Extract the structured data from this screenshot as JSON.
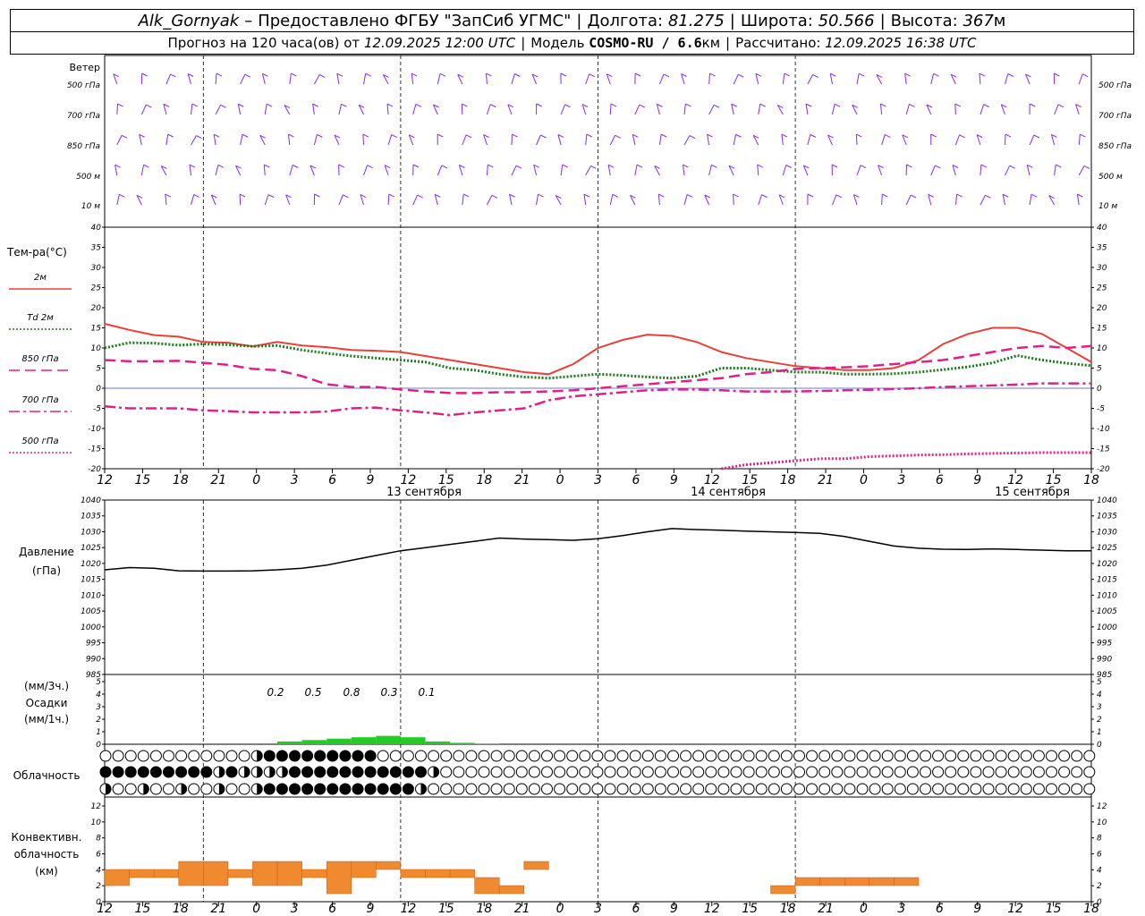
{
  "header": {
    "station": "Alk_Gornyak",
    "provider": "Предоставлено ФГБУ \"ЗапСиб УГМС\"",
    "lon_label": "Долгота:",
    "lon_value": "81.275",
    "lat_label": "Широта:",
    "lat_value": "50.566",
    "alt_label": "Высота:",
    "alt_value": "367",
    "alt_unit": "м",
    "forecast_prefix": "Прогноз на 120 часа(ов) от",
    "forecast_start": "12.09.2025 12:00 UTC",
    "model_label": "Модель",
    "model_value": "COSMO-RU / 6.6",
    "model_unit": "км",
    "computed_label": "Рассчитано:",
    "computed_value": "12.09.2025 16:38 UTC"
  },
  "wind_panel": {
    "title": "Ветер",
    "levels": [
      "500 гПа",
      "700 гПа",
      "850 гПа",
      "500 м",
      "10 м"
    ],
    "barb_color": "#8a2be2"
  },
  "time_axis": {
    "hour_labels": [
      "12",
      "15",
      "18",
      "21",
      "0",
      "3",
      "6",
      "9",
      "12",
      "15",
      "18",
      "21",
      "0",
      "3",
      "6",
      "9",
      "12",
      "15",
      "18",
      "21",
      "0",
      "3",
      "6",
      "9",
      "12",
      "15",
      "18"
    ],
    "day_labels": [
      "13 сентября",
      "14 сентября",
      "15 сентября"
    ]
  },
  "temp_panel": {
    "title": "Тем-ра(°C)",
    "y_ticks": [
      "40",
      "35",
      "30",
      "25",
      "20",
      "15",
      "10",
      "5",
      "0",
      "-5",
      "-10",
      "-15",
      "-20"
    ],
    "legend": [
      {
        "label": "2м",
        "color": "#e8403a",
        "style": "solid"
      },
      {
        "label": "Td  2м",
        "color": "#1a7a1a",
        "style": "dotted"
      },
      {
        "label": "850 гПа",
        "color": "#e0208a",
        "style": "dashed"
      },
      {
        "label": "700 гПа",
        "color": "#e0208a",
        "style": "dashdot"
      },
      {
        "label": "500 гПа",
        "color": "#e0208a",
        "style": "dotted"
      }
    ]
  },
  "pressure_panel": {
    "title_line1": "Давление",
    "title_line2": "(гПа)",
    "y_ticks": [
      "1040",
      "1035",
      "1030",
      "1025",
      "1020",
      "1015",
      "1010",
      "1005",
      "1000",
      "995",
      "990",
      "985"
    ]
  },
  "precip_panel": {
    "unit3h": "(мм/3ч.)",
    "title": "Осадки",
    "unit1h": "(мм/1ч.)",
    "y_ticks": [
      "5",
      "4",
      "3",
      "2",
      "1",
      "0"
    ],
    "amount_labels": [
      "0.2",
      "0.5",
      "0.8",
      "0.3",
      "0.1"
    ],
    "bar_color": "#22cc22"
  },
  "cloud_panel": {
    "title": "Облачность"
  },
  "conv_panel": {
    "title_line1": "Конвективн.",
    "title_line2": "облачность",
    "title_line3": "(км)",
    "y_ticks": [
      "12",
      "10",
      "8",
      "6",
      "4",
      "2",
      "0"
    ],
    "bar_color": "#f08a30"
  },
  "chart_data": {
    "type": "line",
    "time_hours": [
      0,
      3,
      6,
      9,
      12,
      15,
      18,
      21,
      24,
      27,
      30,
      33,
      36,
      39,
      42,
      45,
      48,
      51,
      54,
      57,
      60,
      63,
      66,
      69,
      72,
      75,
      78,
      81,
      84,
      87,
      90,
      93,
      96,
      99,
      102,
      105,
      108,
      111,
      114,
      117,
      120
    ],
    "series": [
      {
        "name": "2м",
        "unit": "°C",
        "values": [
          16,
          14.5,
          13.2,
          12.8,
          11.5,
          11.3,
          10.4,
          11.5,
          10.6,
          10.2,
          9.5,
          9.3,
          9,
          8,
          7,
          6,
          5,
          4,
          3.5,
          6,
          10,
          12,
          13.3,
          13,
          11.5,
          9,
          7.5,
          6.5,
          5.5,
          5,
          4.5,
          4.5,
          5,
          7,
          11,
          13.5,
          15,
          15,
          13.5,
          10,
          6.5
        ]
      },
      {
        "name": "Td  2м",
        "unit": "°C",
        "values": [
          10,
          11.3,
          11.2,
          10.7,
          11,
          10.8,
          10.4,
          10.6,
          9.5,
          8.7,
          8,
          7.5,
          7,
          6.5,
          5,
          4.5,
          3.5,
          2.8,
          2.5,
          3,
          3.5,
          3.2,
          2.8,
          2.5,
          3,
          5,
          5,
          4.5,
          4,
          4,
          3.5,
          3.5,
          3.6,
          4,
          4.6,
          5.3,
          6.3,
          8.1,
          7,
          6.2,
          5.6
        ]
      },
      {
        "name": "850 гПа",
        "unit": "°C",
        "values": [
          7,
          6.7,
          6.7,
          6.8,
          6.3,
          5.8,
          4.8,
          4.5,
          3,
          1,
          0.3,
          0.3,
          -0.3,
          -0.8,
          -1.2,
          -1.2,
          -1,
          -1,
          -0.8,
          -0.5,
          0,
          0.5,
          1,
          1.5,
          2,
          2.5,
          3.5,
          4,
          4.8,
          5,
          5.2,
          5.5,
          6,
          6.5,
          7,
          8,
          9,
          10,
          10.5,
          10,
          10.5
        ]
      },
      {
        "name": "700 гПа",
        "unit": "°C",
        "values": [
          -4.5,
          -5,
          -5,
          -5,
          -5.5,
          -5.7,
          -6,
          -6,
          -6,
          -5.8,
          -5,
          -4.8,
          -5.5,
          -6,
          -6.7,
          -6,
          -5.5,
          -5,
          -3,
          -2,
          -1.5,
          -1,
          -0.5,
          -0.3,
          -0.3,
          -0.5,
          -0.8,
          -0.8,
          -0.8,
          -0.7,
          -0.5,
          -0.4,
          -0.2,
          0,
          0.3,
          0.5,
          0.7,
          0.9,
          1.2,
          1.2,
          1.2
        ]
      },
      {
        "name": "500 гПа",
        "unit": "°C",
        "values": [
          null,
          null,
          null,
          null,
          null,
          null,
          null,
          null,
          null,
          null,
          null,
          null,
          null,
          null,
          null,
          null,
          null,
          null,
          null,
          null,
          null,
          null,
          null,
          null,
          null,
          -20,
          -19,
          -18.5,
          -18,
          -17.5,
          -17.5,
          -17,
          -16.8,
          -16.6,
          -16.5,
          -16.3,
          -16.2,
          -16.1,
          -16,
          -16,
          -16
        ]
      },
      {
        "name": "Давление",
        "unit": "гПа",
        "values": [
          1018,
          1018.7,
          1018.5,
          1017.7,
          1017.6,
          1017.6,
          1017.7,
          1018,
          1018.5,
          1019.5,
          1021,
          1022.5,
          1024,
          1025,
          1026,
          1027,
          1028,
          1027.7,
          1027.5,
          1027.3,
          1027.8,
          1028.8,
          1030,
          1031,
          1030.7,
          1030.5,
          1030.2,
          1030,
          1029.8,
          1029.5,
          1028.5,
          1027,
          1025.5,
          1024.8,
          1024.5,
          1024.4,
          1024.6,
          1024.4,
          1024.2,
          1024,
          1024
        ]
      },
      {
        "name": "Осадки",
        "unit": "мм/1ч.",
        "values": [
          0,
          0,
          0,
          0,
          0,
          0,
          0,
          0.2,
          0.3,
          0.4,
          0.5,
          0.6,
          0.5,
          0.2,
          0.1,
          0.05,
          0,
          0,
          0,
          0,
          0,
          0,
          0,
          0,
          0,
          0,
          0,
          0,
          0,
          0,
          0,
          0,
          0,
          0,
          0,
          0,
          0,
          0,
          0,
          0,
          0
        ]
      },
      {
        "name": "Конвективн. облачность",
        "unit": "км",
        "values": [
          [
            2,
            4
          ],
          [
            3,
            4
          ],
          [
            3,
            4
          ],
          [
            2,
            5
          ],
          [
            2,
            5
          ],
          [
            3,
            4
          ],
          [
            2,
            5
          ],
          [
            2,
            5
          ],
          [
            3,
            4
          ],
          [
            1,
            5
          ],
          [
            3,
            5
          ],
          [
            4,
            5
          ],
          [
            3,
            4
          ],
          [
            3,
            4
          ],
          [
            3,
            4
          ],
          [
            1,
            3
          ],
          [
            1,
            2
          ],
          [
            4,
            5
          ],
          null,
          null,
          null,
          null,
          null,
          null,
          null,
          null,
          null,
          [
            1,
            2
          ],
          [
            2,
            3
          ],
          [
            2,
            3
          ],
          [
            2,
            3
          ],
          [
            2,
            3
          ],
          [
            2,
            3
          ],
          null,
          null,
          null,
          null,
          null,
          null,
          null,
          null
        ]
      }
    ],
    "cloud_cover_octas": {
      "high": [
        0,
        0,
        0,
        0,
        0,
        0,
        0,
        0,
        0,
        0,
        0,
        0,
        4,
        8,
        8,
        8,
        8,
        8,
        8,
        8,
        8,
        8,
        0,
        0,
        0,
        0,
        0,
        0,
        0,
        0,
        0,
        0,
        0,
        0,
        0,
        0,
        0,
        0,
        0,
        0,
        0,
        0,
        0,
        0,
        0,
        0,
        0,
        0,
        0,
        0,
        0,
        0,
        0,
        0,
        0,
        0,
        0,
        0,
        0,
        0,
        0,
        0,
        0,
        0,
        0,
        0,
        0,
        0,
        0,
        0,
        0,
        0,
        0,
        0,
        0,
        0,
        0,
        0,
        0,
        0,
        0
      ],
      "mid": [
        8,
        8,
        8,
        8,
        8,
        8,
        8,
        8,
        8,
        6,
        8,
        6,
        6,
        6,
        6,
        8,
        8,
        8,
        8,
        8,
        8,
        8,
        8,
        8,
        8,
        8,
        4,
        0,
        0,
        0,
        0,
        0,
        0,
        0,
        0,
        0,
        0,
        0,
        0,
        0,
        0,
        0,
        0,
        0,
        0,
        0,
        0,
        0,
        0,
        0,
        0,
        0,
        0,
        0,
        0,
        0,
        0,
        0,
        0,
        0,
        0,
        0,
        0,
        0,
        0,
        0,
        0,
        0,
        0,
        0,
        0,
        0,
        0,
        0,
        0,
        0,
        0,
        0,
        0,
        0,
        0
      ],
      "low": [
        4,
        0,
        0,
        4,
        0,
        0,
        4,
        0,
        0,
        4,
        0,
        0,
        4,
        8,
        8,
        8,
        8,
        8,
        8,
        8,
        8,
        8,
        8,
        8,
        8,
        4,
        0,
        0,
        0,
        0,
        0,
        0,
        0,
        0,
        0,
        0,
        0,
        0,
        0,
        0,
        0,
        0,
        0,
        0,
        0,
        0,
        0,
        0,
        0,
        0,
        0,
        0,
        0,
        0,
        0,
        0,
        0,
        0,
        0,
        0,
        0,
        0,
        0,
        0,
        0,
        0,
        0,
        0,
        0,
        0,
        0,
        0,
        0,
        0,
        0,
        0,
        0,
        0,
        0,
        0,
        0
      ]
    },
    "ranges": {
      "temp_ylim": [
        -20,
        40
      ],
      "pressure_ylim": [
        985,
        1040
      ],
      "precip_ylim": [
        0,
        5
      ],
      "conv_ylim": [
        0,
        13
      ]
    }
  }
}
